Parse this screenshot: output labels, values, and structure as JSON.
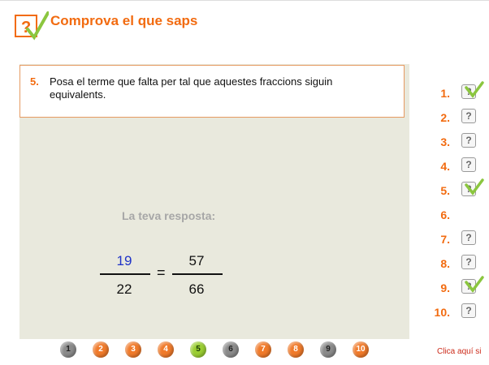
{
  "header": {
    "title": "Comprova el que saps"
  },
  "question": {
    "number": "5.",
    "text": "Posa el terme que falta per tal que aquestes fraccions siguin equivalents."
  },
  "answer": {
    "label": "La teva resposta:",
    "left_numerator": "19",
    "left_denominator": "22",
    "equals": "=",
    "right_numerator": "57",
    "right_denominator": "66"
  },
  "side_list": [
    {
      "label": "1.",
      "status": "correct"
    },
    {
      "label": "2.",
      "status": "unanswered"
    },
    {
      "label": "3.",
      "status": "unanswered"
    },
    {
      "label": "4.",
      "status": "unanswered"
    },
    {
      "label": "5.",
      "status": "correct"
    },
    {
      "label": "6.",
      "status": "current"
    },
    {
      "label": "7.",
      "status": "unanswered"
    },
    {
      "label": "8.",
      "status": "unanswered"
    },
    {
      "label": "9.",
      "status": "correct"
    },
    {
      "label": "10.",
      "status": "unanswered"
    }
  ],
  "question_icon": "?",
  "pager": [
    {
      "label": "1",
      "color": "gray"
    },
    {
      "label": "2",
      "color": "orange"
    },
    {
      "label": "3",
      "color": "orange"
    },
    {
      "label": "4",
      "color": "orange"
    },
    {
      "label": "5",
      "color": "green"
    },
    {
      "label": "6",
      "color": "gray"
    },
    {
      "label": "7",
      "color": "orange"
    },
    {
      "label": "8",
      "color": "orange"
    },
    {
      "label": "9",
      "color": "gray"
    },
    {
      "label": "10",
      "color": "orange"
    }
  ],
  "footer": {
    "link": "Clica aquí si"
  },
  "colors": {
    "accent": "#f26b10",
    "answer_blue": "#1f33c7",
    "check_green": "#8bc63f"
  }
}
